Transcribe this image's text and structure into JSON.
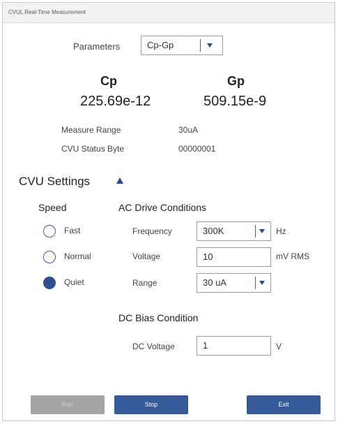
{
  "window": {
    "title": "CVUL Real-Time Measurement"
  },
  "parameters": {
    "label": "Parameters",
    "selected": "Cp-Gp"
  },
  "readings": {
    "primary_name": "Cp",
    "primary_value": "225.69e-12",
    "secondary_name": "Gp",
    "secondary_value": "509.15e-9"
  },
  "info": {
    "measure_range_label": "Measure Range",
    "measure_range_value": "30uA",
    "status_byte_label": "CVU Status Byte",
    "status_byte_value": "00000001"
  },
  "settings": {
    "title": "CVU Settings",
    "speed": {
      "title": "Speed",
      "options": [
        {
          "label": "Fast",
          "selected": false
        },
        {
          "label": "Normal",
          "selected": false
        },
        {
          "label": "Quiet",
          "selected": true
        }
      ]
    },
    "ac": {
      "title": "AC Drive Conditions",
      "frequency_label": "Frequency",
      "frequency_value": "300K",
      "frequency_unit": "Hz",
      "voltage_label": "Voltage",
      "voltage_value": "10",
      "voltage_unit": "mV RMS",
      "range_label": "Range",
      "range_value": "30 uA"
    },
    "dc": {
      "title": "DC Bias Condition",
      "voltage_label": "DC Voltage",
      "voltage_value": "1",
      "voltage_unit": "V"
    }
  },
  "buttons": {
    "run": "Run",
    "stop": "Stop",
    "exit": "Exit"
  },
  "colors": {
    "accent": "#355a97",
    "disabled": "#a4a4a4"
  }
}
